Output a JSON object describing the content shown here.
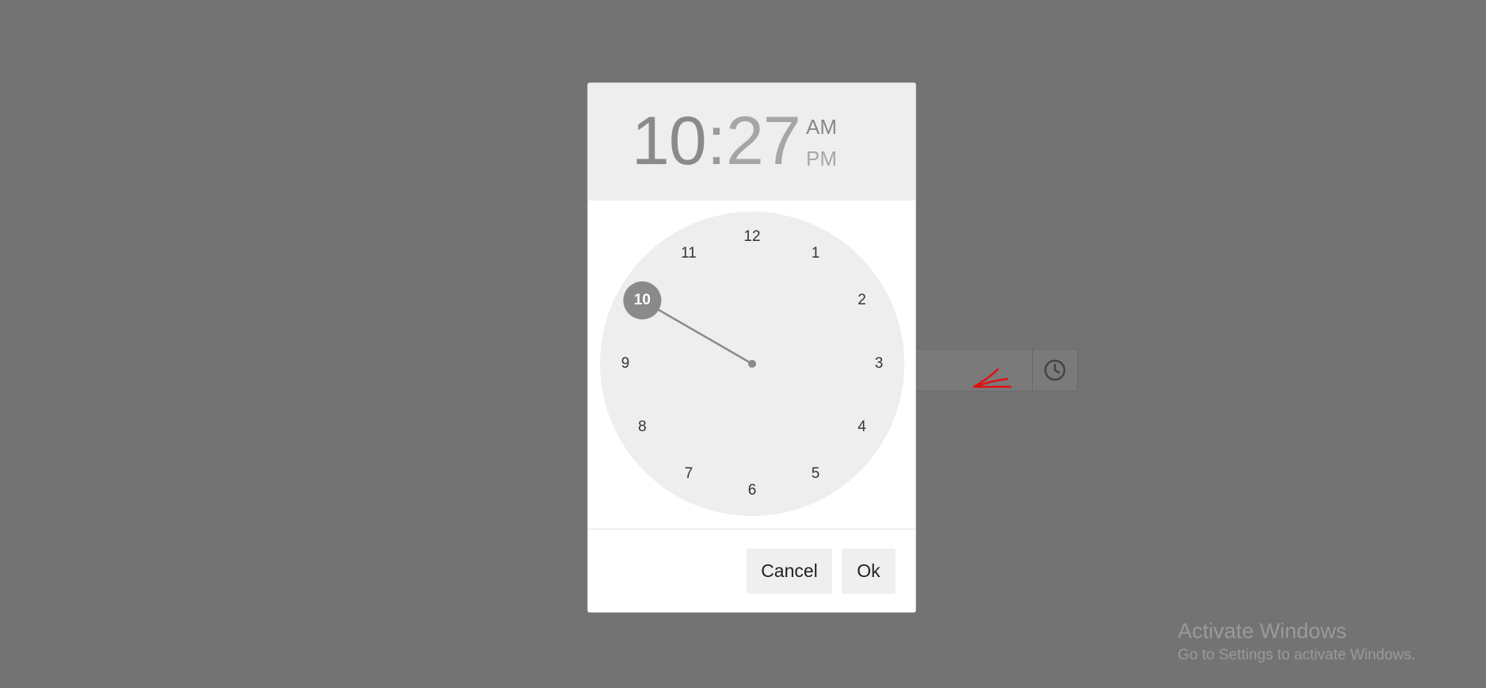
{
  "dialog": {
    "hour": "10",
    "separator": ":",
    "minute": "27",
    "am_label": "AM",
    "pm_label": "PM",
    "selected_period": "AM",
    "selected_hour": 10,
    "clock_numbers": [
      "12",
      "1",
      "2",
      "3",
      "4",
      "5",
      "6",
      "7",
      "8",
      "9",
      "10",
      "11"
    ],
    "cancel_label": "Cancel",
    "ok_label": "Ok"
  },
  "background_input": {
    "icon": "clock-icon"
  },
  "watermark": {
    "title": "Activate Windows",
    "subtitle": "Go to Settings to activate Windows."
  },
  "colors": {
    "overlay": "#737373",
    "header_bg": "#eeeeee",
    "clock_face": "#eeeeee",
    "selected": "#8a8a8a",
    "annotation": "#e01010"
  }
}
